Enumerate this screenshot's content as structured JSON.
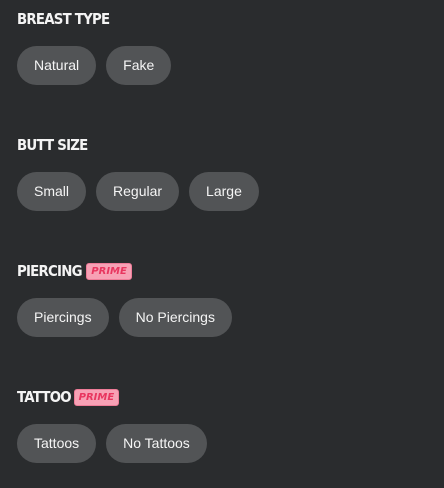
{
  "sections": [
    {
      "title": "BREAST TYPE",
      "options": [
        "Natural",
        "Fake"
      ]
    },
    {
      "title": "BUTT SIZE",
      "options": [
        "Small",
        "Regular",
        "Large"
      ]
    },
    {
      "title": "PIERCING",
      "badge": "PRIME",
      "options": [
        "Piercings",
        "No Piercings"
      ]
    },
    {
      "title": "TATTOO",
      "badge": "PRIME",
      "options": [
        "Tattoos",
        "No Tattoos"
      ]
    }
  ],
  "colors": {
    "background": "#2a2c2e",
    "chip_background": "#525456",
    "badge_text": "#e8365f",
    "badge_background": "#f7a1b5"
  }
}
